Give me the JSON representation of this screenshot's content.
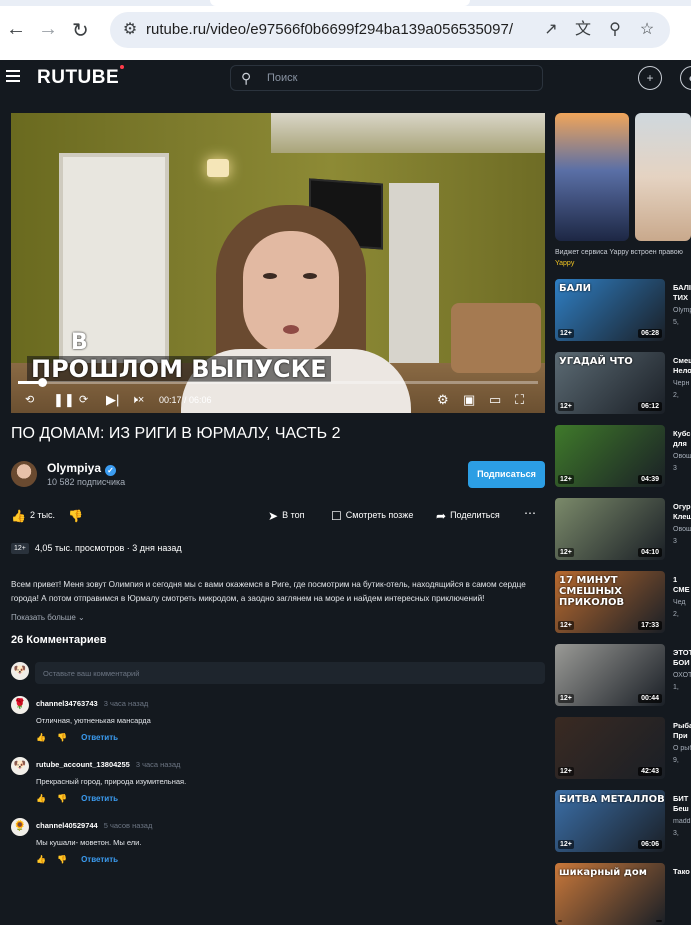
{
  "browser": {
    "url": "rutube.ru/video/e97566f0b6699f294ba139a056535097/"
  },
  "header": {
    "logo": "RUTUBE",
    "search_placeholder": "Поиск"
  },
  "player": {
    "caption_line1": "В",
    "caption_line2": "ПРОШЛОМ ВЫПУСКЕ",
    "time": "00:17 / 06:06",
    "progress": 0.046
  },
  "video": {
    "title": "ПО ДОМАМ: ИЗ РИГИ В ЮРМАЛУ, ЧАСТЬ 2",
    "channel": "Olympiya",
    "subscribers": "10 582 подписчика",
    "subscribe_label": "Подписаться",
    "likes": "2 тыс.",
    "to_top": "В топ",
    "watch_later": "Смотреть позже",
    "share": "Поделиться",
    "age": "12+",
    "views": "4,05 тыс. просмотров",
    "posted": "3 дня назад",
    "description": "Всем привет! Меня зовут Олимпия и сегодня мы с вами окажемся в Риге, где посмотрим на бутик-отель, находящийся в самом сердце города! А потом отправимся в Юрмалу смотреть микродом, а заодно заглянем на море и найдем интересных приключений!",
    "show_more": "Показать больше"
  },
  "comments": {
    "title": "26 Комментариев",
    "input_placeholder": "Оставьте ваш комментарий",
    "reply_label": "Ответить",
    "items": [
      {
        "author": "channel34763743",
        "time": "3 часа назад",
        "text": "Отличная, уютненькая мансарда"
      },
      {
        "author": "rutube_account_13804255",
        "time": "3 часа назад",
        "text": "Прекрасный город, природа изумительная."
      },
      {
        "author": "channel40529744",
        "time": "5 часов назад",
        "text": "Мы кушали- моветон. Мы ели."
      }
    ]
  },
  "sidebar": {
    "reel_caption": "Виджет сервиса Yappy встроен правою",
    "reel_author": "Yappy",
    "videos": [
      {
        "title": "БАЛІ",
        "title2": "ТИХ",
        "author": "Olymp",
        "views": "5,",
        "age": "12+",
        "duration": "06:28",
        "overlay": "БАЛИ",
        "color": "#2f7fc4"
      },
      {
        "title": "Смеш",
        "title2": "Нело",
        "author": "Черн",
        "views": "2,",
        "age": "12+",
        "duration": "06:12",
        "overlay": "УГАДАЙ ЧТО",
        "color": "#5c6b74"
      },
      {
        "title": "Кубс",
        "title2": "для",
        "author": "Овощ",
        "views": "3",
        "age": "12+",
        "duration": "04:39",
        "overlay": "",
        "color": "#3f7a2a"
      },
      {
        "title": "Огур",
        "title2": "Клещ",
        "author": "Овощ",
        "views": "3",
        "age": "12+",
        "duration": "04:10",
        "overlay": "",
        "color": "#7b8a6a"
      },
      {
        "title": "1",
        "title2": "СМЕ",
        "author": "Чед",
        "views": "2,",
        "age": "12+",
        "duration": "17:33",
        "overlay": "17 МИНУТ СМЕШНЫХ ПРИКОЛОВ",
        "color": "#b86a2f"
      },
      {
        "title": "ЭТОТ",
        "title2": "БОИ",
        "author": "ОХОТ",
        "views": "1,",
        "age": "12+",
        "duration": "00:44",
        "overlay": "",
        "color": "#9a9a96"
      },
      {
        "title": "Рыба",
        "title2": "При",
        "author": "О рыб",
        "views": "9,",
        "age": "12+",
        "duration": "42:43",
        "overlay": "",
        "color": "#3a2a22"
      },
      {
        "title": "БИТ",
        "title2": "Беш",
        "author": "madd",
        "views": "3,",
        "age": "12+",
        "duration": "06:06",
        "overlay": "БИТВА МЕТАЛЛОВ",
        "color": "#3b6fa8"
      },
      {
        "title": "Тако",
        "title2": "",
        "author": "",
        "views": "",
        "age": "",
        "duration": "",
        "overlay": "шикарный дом",
        "color": "#c9783a"
      }
    ]
  }
}
